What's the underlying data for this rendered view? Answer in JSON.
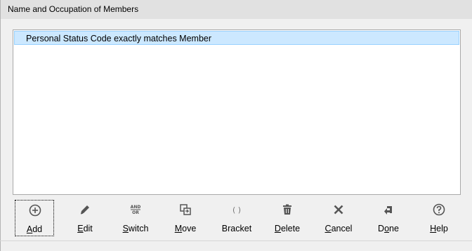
{
  "header": {
    "title": "Name and Occupation of Members"
  },
  "criteria_list": {
    "rows": [
      {
        "text": "Personal Status Code exactly matches Member",
        "selected": true
      }
    ]
  },
  "toolbar": {
    "buttons": [
      {
        "mnemonic": "A",
        "rest": "dd",
        "icon": "add-icon"
      },
      {
        "mnemonic": "E",
        "rest": "dit",
        "icon": "edit-icon"
      },
      {
        "mnemonic": "S",
        "rest": "witch",
        "icon": "switch-icon",
        "icon_text_top": "AND",
        "icon_text_bottom": "OR"
      },
      {
        "mnemonic": "M",
        "rest": "ove",
        "icon": "move-icon"
      },
      {
        "mnemonic": "",
        "rest": "Bracket",
        "icon": "bracket-icon",
        "icon_text": "( )"
      },
      {
        "mnemonic": "D",
        "rest": "elete",
        "icon": "delete-icon"
      },
      {
        "mnemonic": "C",
        "rest": "ancel",
        "icon": "cancel-icon"
      },
      {
        "mnemonic": "",
        "rest": "Done",
        "icon": "done-icon",
        "prefix": "D",
        "mid": "o",
        "tail": "ne"
      },
      {
        "mnemonic": "H",
        "rest": "elp",
        "icon": "help-icon"
      }
    ]
  },
  "colors": {
    "header_bg": "#e1e1e1",
    "panel_bg": "#f0f0f0",
    "selection_bg": "#cce8ff",
    "selection_border": "#99d1ff",
    "icon_color": "#555555"
  }
}
